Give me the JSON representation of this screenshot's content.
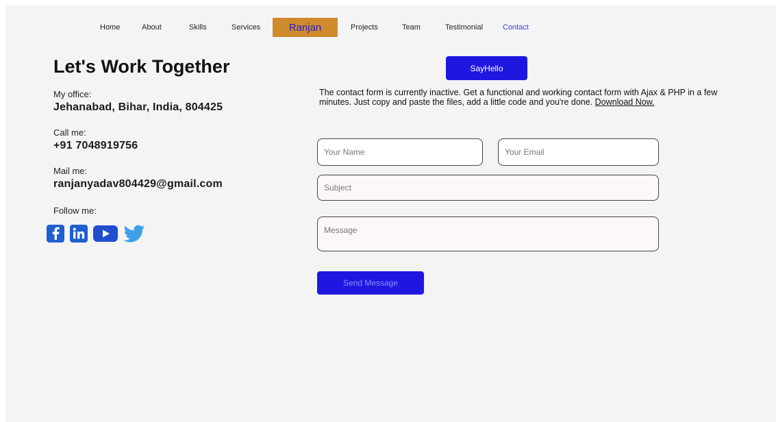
{
  "nav": {
    "items": [
      {
        "label": "Home"
      },
      {
        "label": "About"
      },
      {
        "label": "Skills"
      },
      {
        "label": "Services"
      },
      {
        "label": "Projects"
      },
      {
        "label": "Team"
      },
      {
        "label": "Testimonial"
      },
      {
        "label": "Contact"
      }
    ],
    "brand": "Ranjan",
    "active": "Contact",
    "active_color": "#3a3aee",
    "brand_bg": "#cf8a2e"
  },
  "contact": {
    "heading": "Let's Work Together",
    "office_label": "My office:",
    "office_value": "Jehanabad, Bihar, India, 804425",
    "call_label": "Call me:",
    "call_value": "+91 7048919756",
    "mail_label": "Mail me:",
    "mail_value": "ranjanyadav804429@gmail.com",
    "follow_label": "Follow me:",
    "socials": [
      "facebook-icon",
      "linkedin-icon",
      "youtube-icon",
      "twitter-icon"
    ]
  },
  "form": {
    "say_hello": "SayHello",
    "description": "The contact form is currently inactive. Get a functional and working contact form with Ajax & PHP in a few minutes. Just copy and paste the files, add a little code and you're done.",
    "download_link": "Download Now.",
    "name_placeholder": "Your Name",
    "email_placeholder": "Your Email",
    "subject_placeholder": "Subject",
    "message_placeholder": "Message",
    "send_label": "Send Message",
    "accent_color": "#1f17e0"
  }
}
